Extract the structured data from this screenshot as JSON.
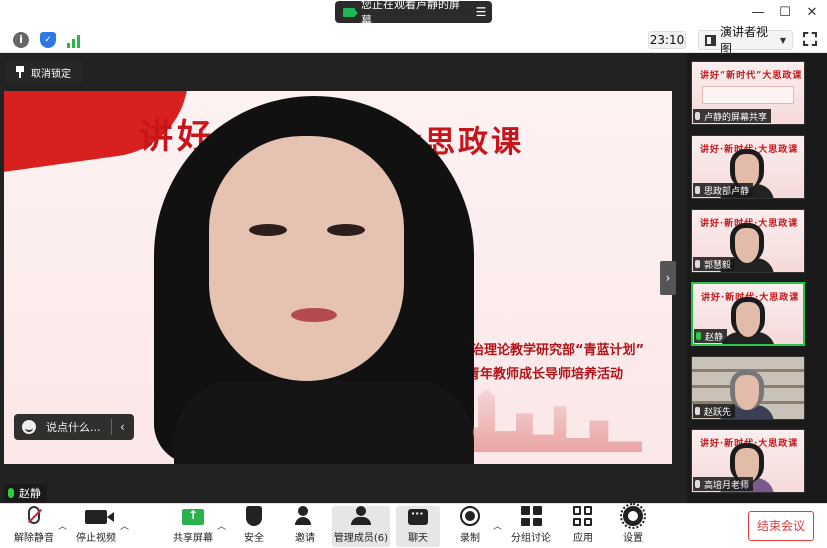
{
  "titlebar": {
    "share_notice": "您正在观看卢静的屏幕",
    "menu_icon": "hamburger-icon",
    "min_icon": "minimize-icon",
    "max_icon": "maximize-icon",
    "close_icon": "close-icon"
  },
  "toolbar": {
    "timer": "23:10",
    "view_label": "演讲者视图"
  },
  "main": {
    "unpin_label": "取消锁定",
    "slide_banner_left": "讲好",
    "slide_banner_right": "大思政课",
    "slide_dept": "思想政治理论教学研究部“青蓝计划”",
    "slide_activity": "青年教师成长导师培养活动",
    "chat_placeholder": "说点什么...",
    "speaker_name": "赵静"
  },
  "gallery": {
    "items": [
      {
        "label": "卢静的屏幕共享",
        "title": "讲好“新时代”大思政课",
        "mic": "muted"
      },
      {
        "label": "思政部卢静",
        "title": "讲好·新时代·大思政课",
        "mic": "muted"
      },
      {
        "label": "郭慧毅",
        "title": "讲好·新时代·大思政课",
        "mic": "muted"
      },
      {
        "label": "赵静",
        "title": "讲好·新时代·大思政课",
        "mic": "on"
      },
      {
        "label": "赵跃先",
        "title": "",
        "mic": "muted"
      },
      {
        "label": "高培月老师",
        "title": "讲好·新时代·大思政课",
        "mic": "muted"
      }
    ]
  },
  "bottombar": {
    "unmute": "解除静音",
    "stop_video": "停止视频",
    "share_screen": "共享屏幕",
    "security": "安全",
    "invite": "邀请",
    "participants": "管理成员(6)",
    "chat": "聊天",
    "record": "录制",
    "breakout": "分组讨论",
    "apps": "应用",
    "settings": "设置",
    "end_meeting": "结束会议"
  },
  "colors": {
    "accent_green": "#2bb24c",
    "end_red": "#e23d3d",
    "slide_red": "#c8151b"
  }
}
